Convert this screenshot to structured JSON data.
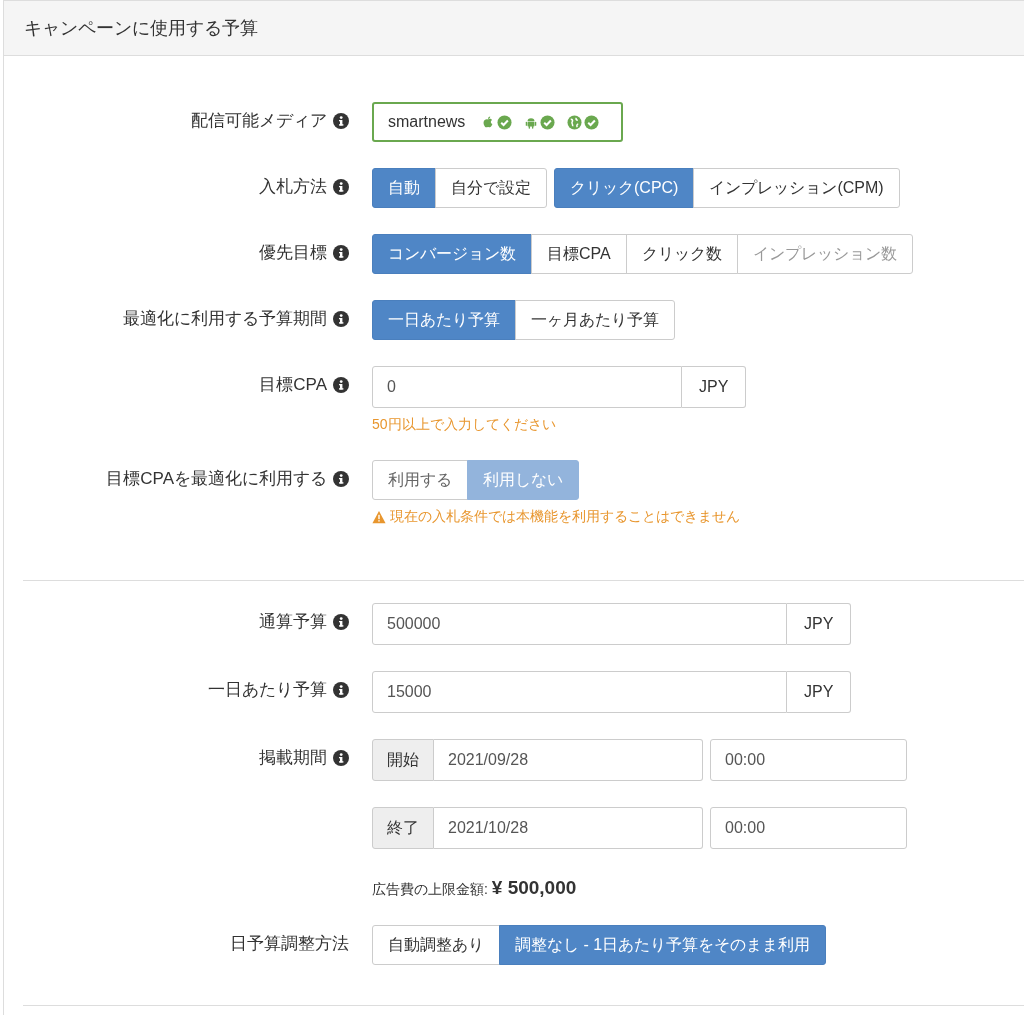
{
  "panel": {
    "title": "キャンペーンに使用する予算"
  },
  "sections": [
    {
      "rows": [
        {
          "kind": "media",
          "label": "配信可能メディア",
          "info": true,
          "media": {
            "name": "smartnews",
            "platforms": [
              {
                "kind": "apple",
                "checked": true
              },
              {
                "kind": "android",
                "checked": true
              },
              {
                "kind": "globe",
                "checked": true
              }
            ]
          }
        },
        {
          "kind": "buttons",
          "label": "入札方法",
          "info": true,
          "disabled": false,
          "groups": [
            [
              {
                "label": "自動",
                "selected": true,
                "disabled": false
              },
              {
                "label": "自分で設定",
                "selected": false,
                "disabled": false
              }
            ],
            [
              {
                "label": "クリック(CPC)",
                "selected": true,
                "disabled": false
              },
              {
                "label": "インプレッション(CPM)",
                "selected": false,
                "disabled": false
              }
            ]
          ]
        },
        {
          "kind": "buttons",
          "label": "優先目標",
          "info": true,
          "disabled": false,
          "groups": [
            [
              {
                "label": "コンバージョン数",
                "selected": true,
                "disabled": false
              },
              {
                "label": "目標CPA",
                "selected": false,
                "disabled": false
              },
              {
                "label": "クリック数",
                "selected": false,
                "disabled": false
              },
              {
                "label": "インプレッション数",
                "selected": false,
                "disabled": true
              }
            ]
          ]
        },
        {
          "kind": "buttons",
          "label": "最適化に利用する予算期間",
          "info": true,
          "disabled": false,
          "groups": [
            [
              {
                "label": "一日あたり予算",
                "selected": true,
                "disabled": false
              },
              {
                "label": "一ヶ月あたり予算",
                "selected": false,
                "disabled": false
              }
            ]
          ]
        },
        {
          "kind": "input",
          "label": "目標CPA",
          "info": true,
          "value": "0",
          "addon": "JPY",
          "wide": false,
          "note": "50円以上で入力してください"
        },
        {
          "kind": "buttons",
          "label": "目標CPAを最適化に利用する",
          "info": true,
          "disabled": true,
          "groups": [
            [
              {
                "label": "利用する",
                "selected": false
              },
              {
                "label": "利用しない",
                "selected": true
              }
            ]
          ],
          "warning": "現在の入札条件では本機能を利用することはできません"
        }
      ]
    },
    {
      "rows": [
        {
          "kind": "input",
          "label": "通算予算",
          "info": true,
          "value": "500000",
          "addon": "JPY",
          "wide": true
        },
        {
          "kind": "input",
          "label": "一日あたり予算",
          "info": true,
          "value": "15000",
          "addon": "JPY",
          "wide": true
        },
        {
          "kind": "dates",
          "label": "掲載期間",
          "info": true,
          "ranges": [
            {
              "addon": "開始",
              "date": "2021/09/28",
              "time": "00:00"
            },
            {
              "addon": "終了",
              "date": "2021/10/28",
              "time": "00:00"
            }
          ]
        },
        {
          "kind": "total",
          "caption": "広告費の上限金額:",
          "amount": "¥ 500,000"
        },
        {
          "kind": "buttons",
          "label": "日予算調整方法",
          "info": false,
          "disabled": false,
          "groups": [
            [
              {
                "label": "自動調整あり",
                "selected": false,
                "disabled": false
              },
              {
                "label": "調整なし - 1日あたり予算をそのまま利用",
                "selected": true,
                "disabled": false
              }
            ]
          ]
        }
      ]
    }
  ]
}
